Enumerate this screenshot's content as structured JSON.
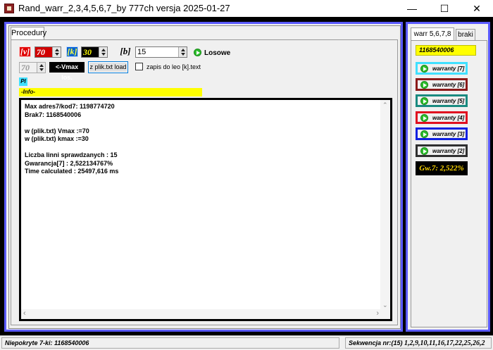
{
  "window": {
    "title": "Rand_warr_2,3,4,5,6,7_by 777ch  versja 2025-01-27",
    "minimize": "—",
    "maximize": "☐",
    "close": "✕"
  },
  "left": {
    "tab": "Procedury",
    "v_chip": "[v]",
    "v_value": "70",
    "k_chip": "[k]",
    "k_value": "30",
    "b_chip": "[b]",
    "b_value": "15",
    "losowe": "Losowe",
    "vmax_gray": "70",
    "vmax_btn": "<-Vmax los.",
    "load_btn": "z plik.txt load",
    "checkbox_label": "zapis do leo [k].text",
    "pl_chip": "Pl",
    "info_bar": "-Info-",
    "memo_lines": [
      "Max adres7/kod7: 1198774720",
      "Brak7: 1168540006",
      "",
      "w (plik.txt) Vmax :=70",
      "w (plik.txt) kmax :=30",
      "",
      "Liczba linni sprawdzanych : 15",
      "Gwarancja[7] : 2,522134767%",
      "Time calculated : 25497,616 ms"
    ]
  },
  "right": {
    "tab_warr": "warr 5,6,7,8",
    "tab_braki": "braki",
    "brak_value": "1168540006",
    "buttons": [
      "warranty [7]",
      "warranty [6]",
      "warranty [5]",
      "warranty [4]",
      "warranty [3]",
      "warranty [2]"
    ],
    "gw": "Gw.7: 2,522%"
  },
  "status": {
    "left": "Niepokryte 7-ki: 1168540006",
    "right_label": "Sekwencja nr:(15)",
    "right_seq": "1,2,9,10,11,16,17,22,25,26,2"
  },
  "colors": {
    "frame_border": "#5a5aff",
    "info_yellow": "#ffff00",
    "v_red": "#d00000",
    "k_black": "#000000"
  }
}
